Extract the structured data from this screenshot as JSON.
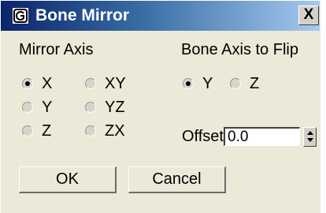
{
  "window": {
    "title": "Bone Mirror",
    "close_label": "X"
  },
  "mirror_axis": {
    "label": "Mirror Axis",
    "options": [
      {
        "label": "X",
        "selected": true
      },
      {
        "label": "Y",
        "selected": false
      },
      {
        "label": "Z",
        "selected": false
      },
      {
        "label": "XY",
        "selected": false
      },
      {
        "label": "YZ",
        "selected": false
      },
      {
        "label": "ZX",
        "selected": false
      }
    ]
  },
  "bone_axis": {
    "label": "Bone Axis to Flip",
    "options": [
      {
        "label": "Y",
        "selected": true
      },
      {
        "label": "Z",
        "selected": false
      }
    ]
  },
  "offset": {
    "label": "Offset",
    "value": "0.0"
  },
  "buttons": {
    "ok_label": "OK",
    "cancel_label": "Cancel"
  },
  "colors": {
    "title_gradient_start": "#0a246a",
    "title_gradient_end": "#a6caf0",
    "dialog_background": "#ece9d8"
  }
}
